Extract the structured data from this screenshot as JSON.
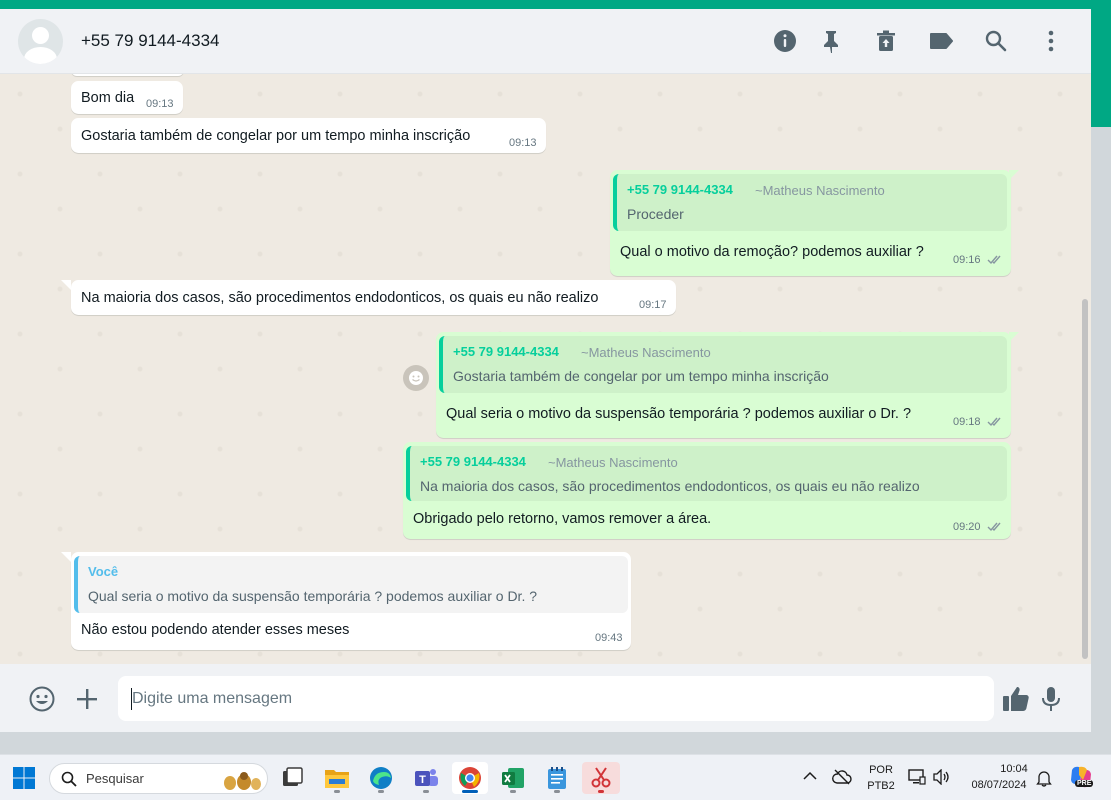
{
  "header": {
    "contact_name": "+55 79 9144-4334",
    "icons": [
      "info-icon",
      "pin-icon",
      "delete-icon",
      "label-icon",
      "search-icon",
      "menu-icon"
    ]
  },
  "messages": [
    {
      "direction": "in",
      "text": "Bom dia",
      "time": "09:13"
    },
    {
      "direction": "in",
      "text": "Gostaria também de congelar por um tempo minha inscrição",
      "time": "09:13"
    },
    {
      "direction": "out",
      "quote": {
        "name": "+55 79 9144-4334",
        "pushname": "~Matheus Nascimento",
        "text": "Proceder"
      },
      "text": "Qual o motivo da remoção? podemos auxiliar ?",
      "time": "09:16"
    },
    {
      "direction": "in",
      "text": "Na maioria dos casos, são procedimentos endodonticos, os quais eu não realizo",
      "time": "09:17"
    },
    {
      "direction": "out",
      "quote": {
        "name": "+55 79 9144-4334",
        "pushname": "~Matheus Nascimento",
        "text": "Gostaria também de congelar por um tempo minha inscrição"
      },
      "text": "Qual seria o motivo da suspensão temporária ?  podemos auxiliar o Dr. ?",
      "time": "09:18"
    },
    {
      "direction": "out",
      "quote": {
        "name": "+55 79 9144-4334",
        "pushname": "~Matheus Nascimento",
        "text": "Na maioria dos casos, são procedimentos endodonticos, os quais eu não realizo"
      },
      "text": "Obrigado pelo retorno, vamos remover a área.",
      "time": "09:20"
    },
    {
      "direction": "in",
      "quote": {
        "name": "Você",
        "pushname": "",
        "text": "Qual seria o motivo da suspensão temporária ?  podemos auxiliar o Dr. ?"
      },
      "text": "Não estou podendo atender esses meses",
      "time": "09:43"
    }
  ],
  "composer": {
    "placeholder": "Digite uma mensagem"
  },
  "taskbar": {
    "search_label": "Pesquisar",
    "language_line1": "POR",
    "language_line2": "PTB2",
    "time": "10:04",
    "date": "08/07/2024",
    "copilot_badge": "PRE"
  },
  "colors": {
    "accent": "#00a884",
    "incoming_bubble": "#ffffff",
    "outgoing_bubble": "#d9fdd3",
    "quote_name": "#06cf9c",
    "self_quote": "#53bdeb",
    "read_ticks": "#8696a0"
  }
}
